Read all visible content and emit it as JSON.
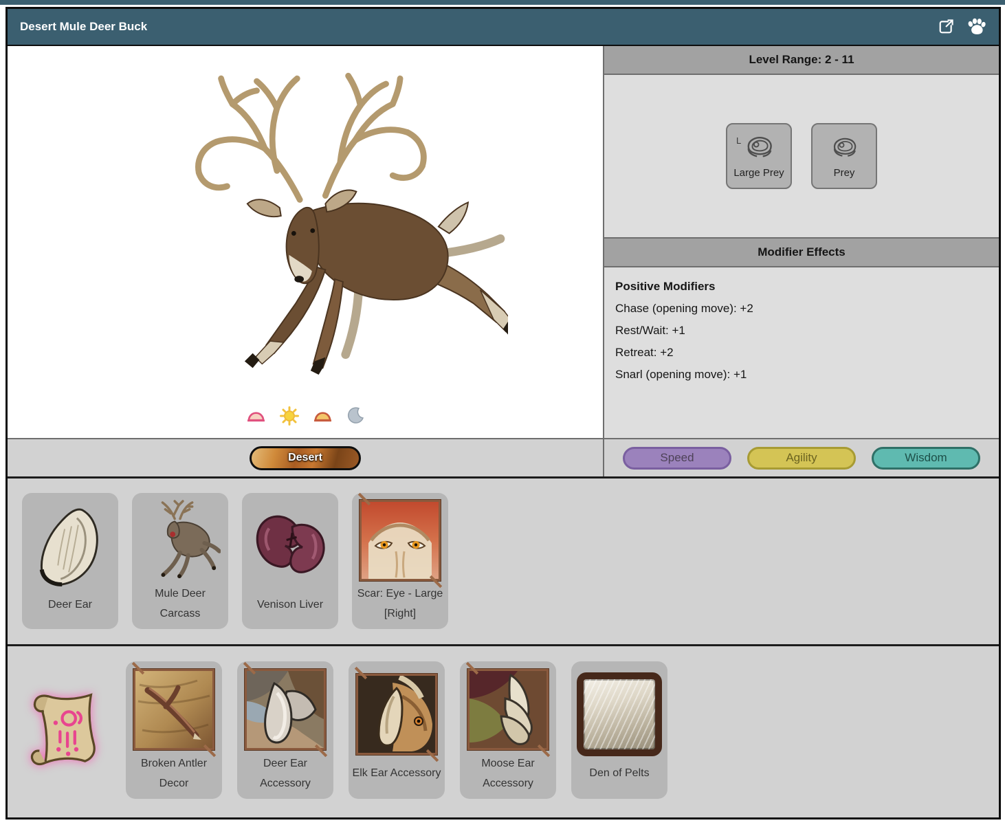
{
  "colors": {
    "titlebar": "#3b5f70",
    "panel_header": "#a2a2a2",
    "panel_body": "#dedede",
    "section_bg": "#d2d2d2",
    "card_bg": "#b6b6b6",
    "speed": "#9b82bc",
    "agility": "#d4c455",
    "wisdom": "#5fbab0"
  },
  "titlebar": {
    "title": "Desert Mule Deer Buck",
    "icons": [
      {
        "name": "external-link-icon"
      },
      {
        "name": "paw-icon"
      }
    ]
  },
  "level_panel": {
    "header": "Level Range: 2 - 11",
    "prey_types": [
      {
        "label": "Large Prey",
        "badge": "L",
        "icon": "steak-icon"
      },
      {
        "label": "Prey",
        "icon": "steak-icon"
      }
    ]
  },
  "modifier_panel": {
    "header": "Modifier Effects",
    "group_title": "Positive Modifiers",
    "modifiers": [
      "Chase (opening move): +2",
      "Rest/Wait: +1",
      "Retreat: +2",
      "Snarl (opening move): +1"
    ]
  },
  "time_of_day": [
    {
      "name": "dawn-icon"
    },
    {
      "name": "day-icon"
    },
    {
      "name": "dusk-icon"
    },
    {
      "name": "night-icon"
    }
  ],
  "biome": {
    "label": "Desert"
  },
  "stats": [
    {
      "label": "Speed"
    },
    {
      "label": "Agility"
    },
    {
      "label": "Wisdom"
    }
  ],
  "drops": [
    {
      "name": "Deer Ear"
    },
    {
      "name": "Mule Deer Carcass"
    },
    {
      "name": "Venison Liver"
    },
    {
      "name": "Scar: Eye - Large [Right]"
    }
  ],
  "craftables": [
    {
      "name": "Broken Antler Decor"
    },
    {
      "name": "Deer Ear Accessory"
    },
    {
      "name": "Elk Ear Accessory"
    },
    {
      "name": "Moose Ear Accessory"
    },
    {
      "name": "Den of Pelts"
    }
  ],
  "recipe_icon": {
    "name": "recipe-scroll-icon"
  }
}
